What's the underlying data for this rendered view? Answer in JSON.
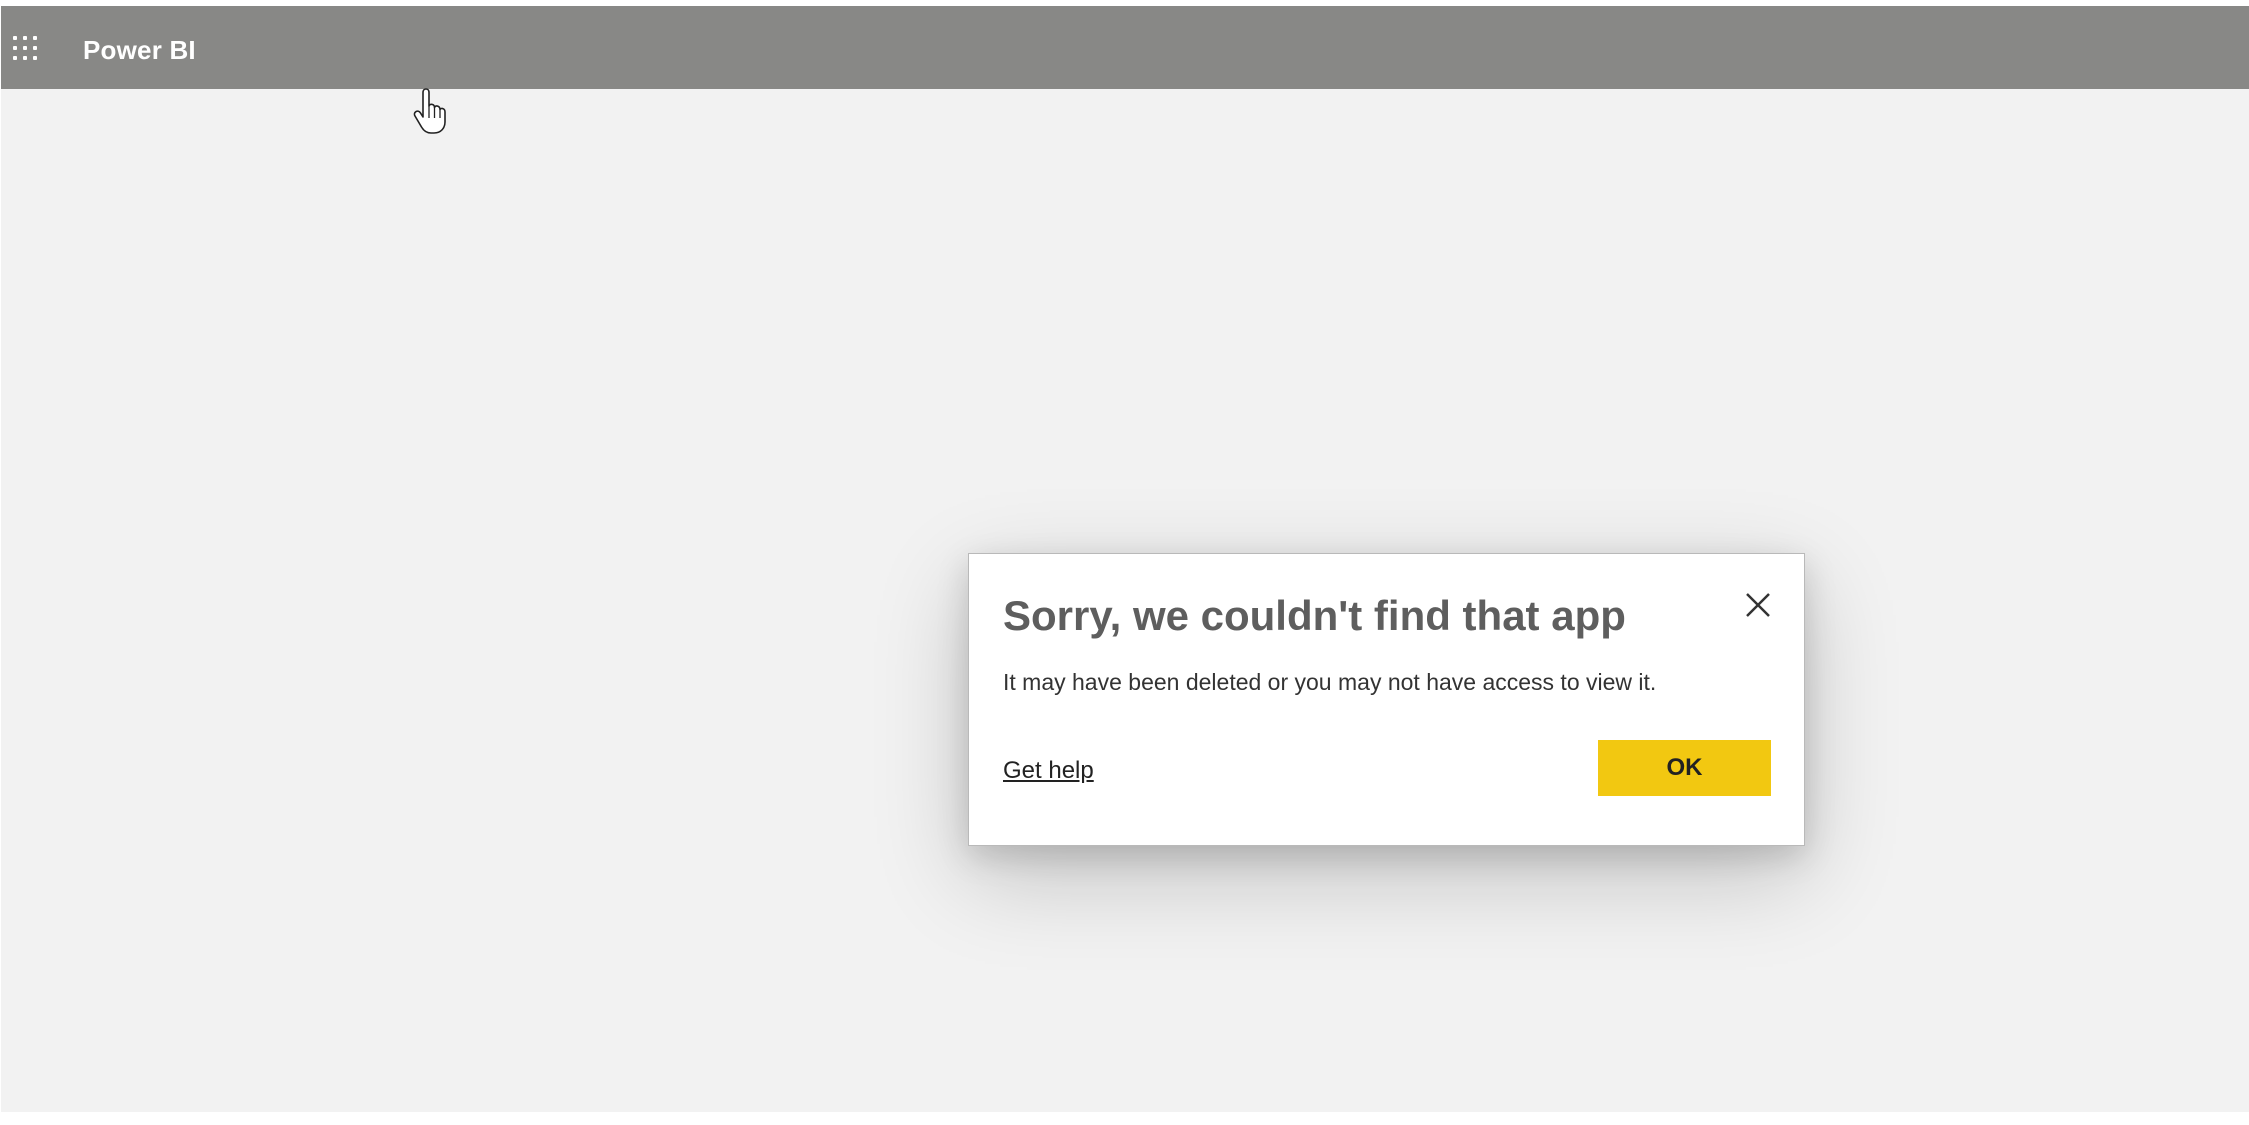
{
  "header": {
    "app_name": "Power BI",
    "launcher_icon": "app-launcher-waffle-icon",
    "background_color": "#888886"
  },
  "canvas": {
    "background_color": "#f2f2f2"
  },
  "dialog": {
    "title": "Sorry, we couldn't find that app",
    "message": "It may have been deleted or you may not have access to view it.",
    "help_link_label": "Get help",
    "ok_label": "OK",
    "close_icon": "close-icon",
    "ok_button_color": "#f2c811"
  },
  "pointer": {
    "icon": "hand-pointer-cursor-icon"
  }
}
